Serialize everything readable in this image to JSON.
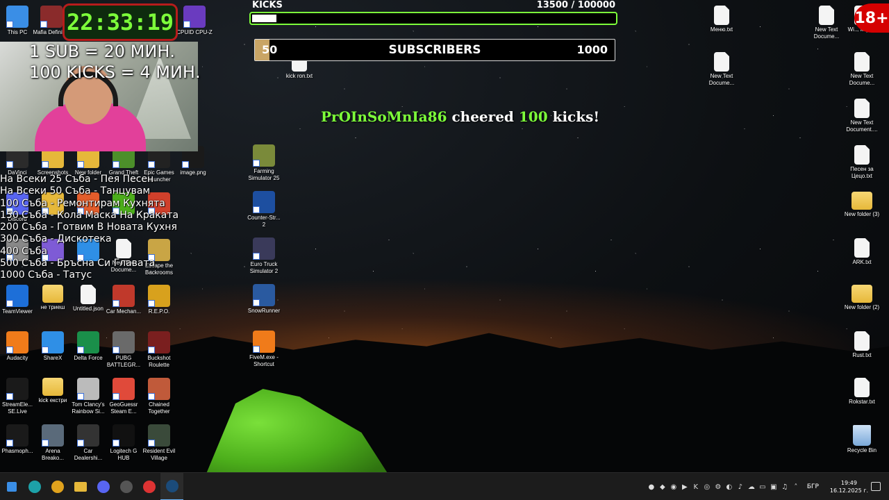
{
  "overlay": {
    "clock": "22:33:19",
    "sub_rule": "1 SUB = 20 МИН.",
    "kicks_rule": "100 KICKS = 4 МИН.",
    "kicks_label": "KICKS",
    "kicks_count": "13500  / 100000",
    "kicks_progress": 0.135,
    "subs_start": "50",
    "subs_label": "SUBSCRIBERS",
    "subs_end": "1000",
    "subs_progress": 0.04,
    "cheer_name": "PrOInSoMnIa86",
    "cheer_mid": "cheered",
    "cheer_num": "100",
    "cheer_end": "kicks!",
    "age_badge": "18+",
    "goals": [
      "На Всеки 25 Съба - Пея Песен",
      "На Всеки 50 Съба - Танцувам",
      "100 Съба - Ремонтирам Кухнята",
      "150 Съба - Кола Маска На Краката",
      "200 Съба - Готвим В Новата Кухня",
      "300 Съба - Дискотека",
      "400 Съба",
      "500 Съба - Бръсна Си Главата",
      "1000 Съба - Татус"
    ]
  },
  "desktop": {
    "left_top": [
      {
        "label": "This PC",
        "color": "#3a8ee6"
      },
      {
        "label": "Mafia Definiti...",
        "color": "#8a2b2b"
      },
      {
        "label": "CPUID CPU-Z",
        "color": "#6a3bbf"
      }
    ],
    "row1": [
      {
        "label": "DaVinci",
        "color": "#2b2b2b"
      },
      {
        "label": "Screenshots",
        "color": "#e6b83a"
      },
      {
        "label": "New folder",
        "color": "#e6b83a"
      },
      {
        "label": "Grand Theft",
        "color": "#4c8f2a"
      },
      {
        "label": "Epic Games Launcher",
        "color": "#222"
      },
      {
        "label": "image.png",
        "color": "#1a1a1a"
      }
    ],
    "row2": [
      {
        "label": "Discord",
        "color": "#5865f2"
      },
      {
        "label": "",
        "color": "#e6b83a"
      },
      {
        "label": "",
        "color": "#e35d2b"
      },
      {
        "label": "",
        "color": "#4cae1b"
      },
      {
        "label": "",
        "color": "#d0402b"
      }
    ],
    "row3": [
      {
        "label": "",
        "color": "#888"
      },
      {
        "label": "",
        "color": "#7e5bd6"
      },
      {
        "label": "",
        "color": "#2f8fe6"
      },
      {
        "label": "New Text Docume...",
        "color": "#f4f4f4"
      },
      {
        "label": "Escape the Backrooms",
        "color": "#c9a545"
      }
    ],
    "row4": [
      {
        "label": "TeamViewer",
        "color": "#1d6fd8"
      },
      {
        "label": "не триеш",
        "color": "#e6b83a"
      },
      {
        "label": "Untitled.json",
        "color": "#f4f4f4"
      },
      {
        "label": "Car Mechan...",
        "color": "#c0392b"
      },
      {
        "label": "R.E.P.O.",
        "color": "#d8a11d"
      }
    ],
    "row5": [
      {
        "label": "Audacity",
        "color": "#f07b1a"
      },
      {
        "label": "ShareX",
        "color": "#2f8fe6"
      },
      {
        "label": "Delta Force",
        "color": "#1a8f4a"
      },
      {
        "label": "PUBG BATTLEGR...",
        "color": "#6a6a6a"
      },
      {
        "label": "Buckshot Roulette",
        "color": "#7a1f1f"
      }
    ],
    "row6": [
      {
        "label": "StreamEle... SE.Live",
        "color": "#1a1a1a"
      },
      {
        "label": "kick екстри",
        "color": "#e6b83a"
      },
      {
        "label": "Tom Clancy's Rainbow Si...",
        "color": "#bbb"
      },
      {
        "label": "GeoGuessr Steam E...",
        "color": "#e04a3a"
      },
      {
        "label": "Chained Together",
        "color": "#c05a3a"
      }
    ],
    "row7": [
      {
        "label": "Phasmoph...",
        "color": "#1a1a1a"
      },
      {
        "label": "Arena Breako...",
        "color": "#5a6a7a"
      },
      {
        "label": "Car Dealershi...",
        "color": "#333"
      },
      {
        "label": "Logitech G HUB",
        "color": "#111"
      },
      {
        "label": "Resident Evil Village",
        "color": "#3a4a3a"
      }
    ],
    "middle": [
      {
        "label": "kick ron.txt",
        "color": "#f4f4f4"
      },
      {
        "label": "Farming Simulator 25",
        "color": "#7a8a3a"
      },
      {
        "label": "Counter-Str... 2",
        "color": "#1d4fa0"
      },
      {
        "label": "Euro Truck Simulator 2",
        "color": "#3a3a5a"
      },
      {
        "label": "SnowRunner",
        "color": "#2a5aa0"
      },
      {
        "label": "FiveM.exe - Shortcut",
        "color": "#f07b1a"
      }
    ],
    "right_col1": [
      {
        "label": "Меню.txt"
      },
      {
        "label": "New Text Docume..."
      }
    ],
    "right_col2": [
      {
        "label": "New Text Docume..."
      }
    ],
    "right_col3": [
      {
        "label": "Wi... key.txt",
        "type": "doc"
      },
      {
        "label": "New Text Docume...",
        "type": "doc"
      },
      {
        "label": "New Text Document....",
        "type": "doc"
      },
      {
        "label": "Песен за Цецо.txt",
        "type": "doc"
      },
      {
        "label": "New folder (3)",
        "type": "folder"
      },
      {
        "label": "ARK.txt",
        "type": "doc"
      },
      {
        "label": "New folder (2)",
        "type": "folder"
      },
      {
        "label": "Rust.txt",
        "type": "doc"
      },
      {
        "label": "Rokstar.txt",
        "type": "doc"
      },
      {
        "label": "Recycle Bin",
        "type": "bin"
      }
    ]
  },
  "taskbar": {
    "apps": [
      {
        "name": "windows-start",
        "color": "#3a8ee6"
      },
      {
        "name": "edge",
        "color": "#1da1a8"
      },
      {
        "name": "chrome",
        "color": "#e0a21d"
      },
      {
        "name": "explorer",
        "color": "#e6b83a"
      },
      {
        "name": "discord",
        "color": "#5865f2"
      },
      {
        "name": "obs",
        "color": "#555"
      },
      {
        "name": "chrome-2",
        "color": "#d33"
      },
      {
        "name": "steam",
        "color": "#1b4b7a"
      }
    ],
    "lang": "БГР",
    "time": "19:49",
    "date": "16.12.2025 г."
  }
}
